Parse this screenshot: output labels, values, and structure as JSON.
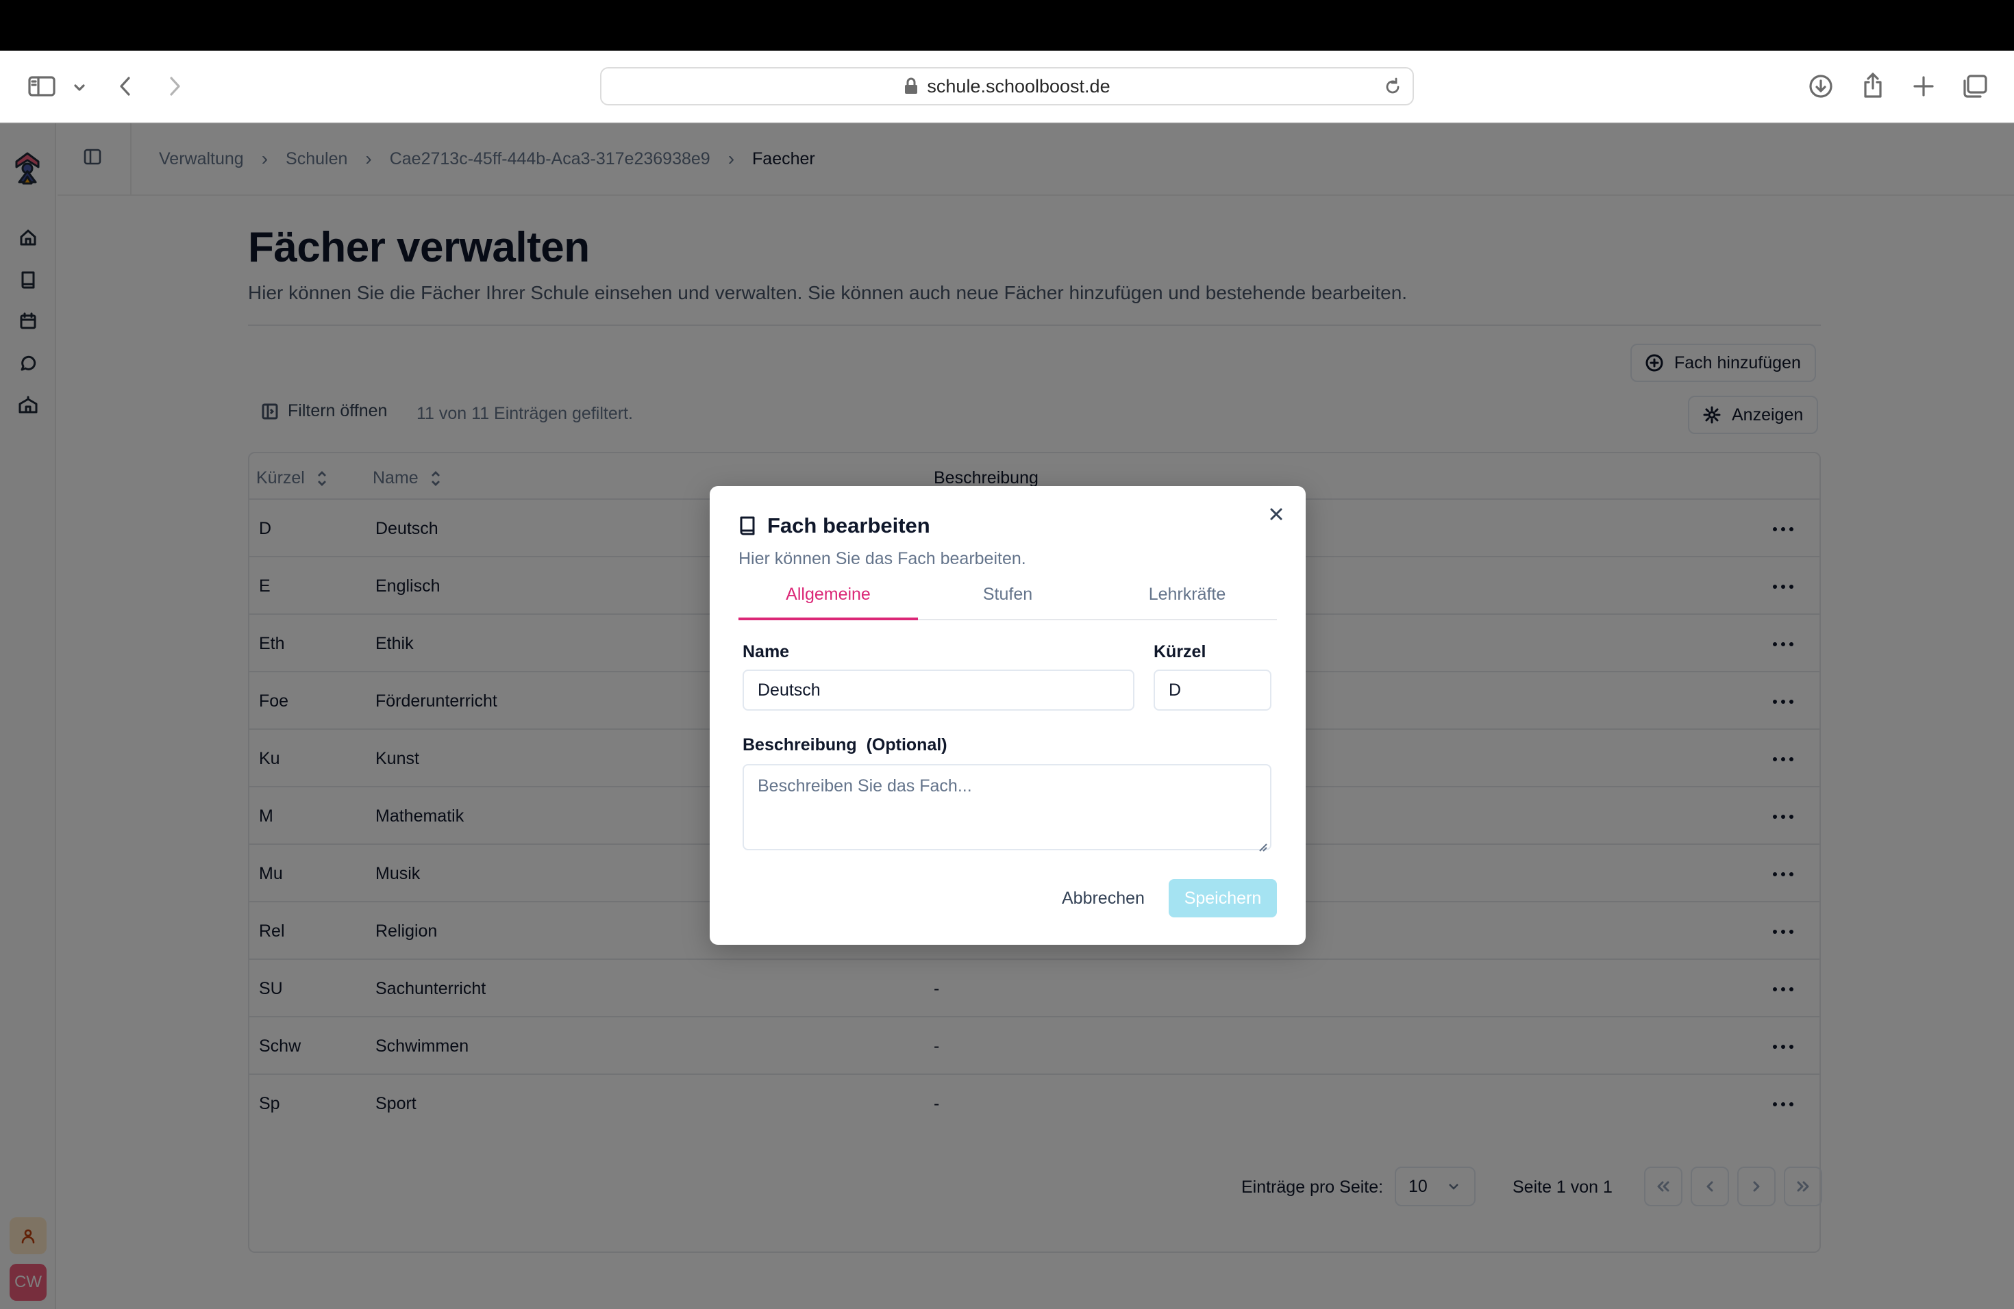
{
  "browser": {
    "url": "schule.schoolboost.de"
  },
  "sidebar": {
    "icons": [
      "logo",
      "home-icon",
      "book-icon",
      "calendar-icon",
      "chat-icon",
      "school-icon"
    ],
    "user_initials": "CW"
  },
  "breadcrumb": {
    "items": [
      "Verwaltung",
      "Schulen",
      "Cae2713c-45ff-444b-Aca3-317e236938e9",
      "Faecher"
    ]
  },
  "page": {
    "title": "Fächer verwalten",
    "subtitle": "Hier können Sie die Fächer Ihrer Schule einsehen und verwalten. Sie können auch neue Fächer hinzufügen und bestehende bearbeiten.",
    "add_button": "Fach hinzufügen",
    "view_button": "Anzeigen",
    "filter_button": "Filtern öffnen",
    "filter_count": "11 von 11 Einträgen gefiltert."
  },
  "table": {
    "headers": {
      "short": "Kürzel",
      "name": "Name",
      "description": "Beschreibung"
    },
    "rows": [
      {
        "short": "D",
        "name": "Deutsch",
        "description": ""
      },
      {
        "short": "E",
        "name": "Englisch",
        "description": ""
      },
      {
        "short": "Eth",
        "name": "Ethik",
        "description": ""
      },
      {
        "short": "Foe",
        "name": "Förderunterricht",
        "description": ""
      },
      {
        "short": "Ku",
        "name": "Kunst",
        "description": ""
      },
      {
        "short": "M",
        "name": "Mathematik",
        "description": ""
      },
      {
        "short": "Mu",
        "name": "Musik",
        "description": ""
      },
      {
        "short": "Rel",
        "name": "Religion",
        "description": ""
      },
      {
        "short": "SU",
        "name": "Sachunterricht",
        "description": "-"
      },
      {
        "short": "Schw",
        "name": "Schwimmen",
        "description": "-"
      },
      {
        "short": "Sp",
        "name": "Sport",
        "description": "-"
      }
    ]
  },
  "pagination": {
    "per_page_label": "Einträge pro Seite:",
    "per_page_value": "10",
    "page_label": "Seite 1 von 1"
  },
  "dialog": {
    "title": "Fach bearbeiten",
    "subtitle": "Hier können Sie das Fach bearbeiten.",
    "tabs": [
      "Allgemeine",
      "Stufen",
      "Lehrkräfte"
    ],
    "active_tab": "Allgemeine",
    "name_label": "Name",
    "name_value": "Deutsch",
    "short_label": "Kürzel",
    "short_value": "D",
    "description_label": "Beschreibung  (Optional)",
    "description_placeholder": "Beschreiben Sie das Fach...",
    "cancel_label": "Abbrechen",
    "save_label": "Speichern"
  },
  "colors": {
    "accent": "#db2777",
    "save_disabled": "#a5e3f2",
    "avatar": "#ef5d7a"
  }
}
